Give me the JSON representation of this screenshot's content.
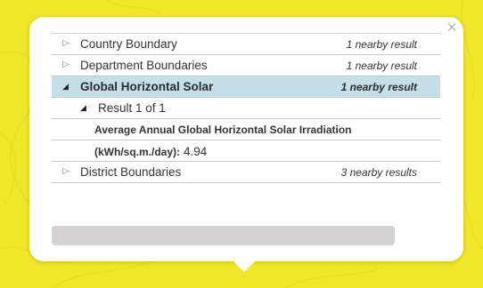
{
  "popup": {
    "close_label": "×",
    "layers": [
      {
        "name": "Country Boundary",
        "count": "1 nearby result"
      },
      {
        "name": "Department Boundaries",
        "count": "1 nearby result"
      },
      {
        "name": "Global Horizontal Solar",
        "count": "1 nearby result",
        "expanded": true
      },
      {
        "name": "District Boundaries",
        "count": "3 nearby results"
      }
    ],
    "result": {
      "label": "Result 1 of 1",
      "attribute_name": "Average Annual Global Horizontal Solar Irradiation",
      "attribute_unit": "(kWh/sq.m./day):",
      "attribute_value": "4.94"
    }
  },
  "colors": {
    "map_background": "#f2e62b",
    "selected_row": "#c5dfe9",
    "scrollbar": "#d4d2d2"
  }
}
